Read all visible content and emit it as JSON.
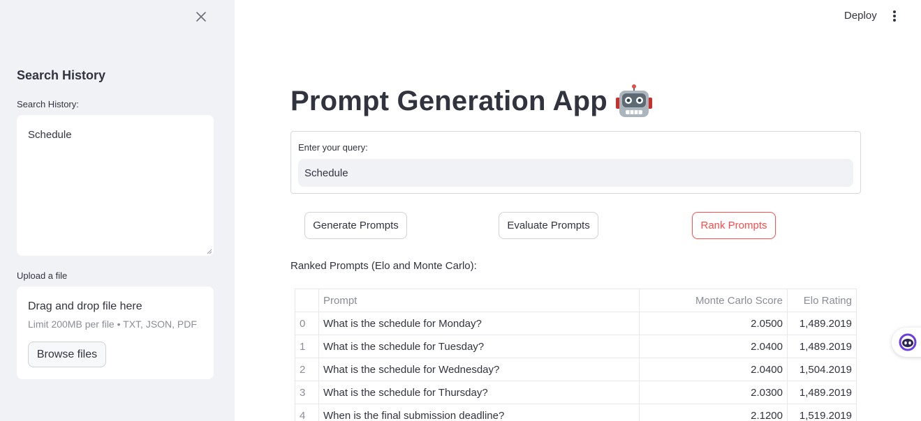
{
  "sidebar": {
    "heading": "Search History",
    "history_label": "Search History:",
    "history_value": "Schedule",
    "upload_label": "Upload a file",
    "upload_title": "Drag and drop file here",
    "upload_limit": "Limit 200MB per file • TXT, JSON, PDF",
    "browse_label": "Browse files"
  },
  "header": {
    "deploy_label": "Deploy"
  },
  "main": {
    "title": "Prompt Generation App",
    "query_label": "Enter your query:",
    "query_value": "Schedule",
    "buttons": {
      "generate": "Generate Prompts",
      "evaluate": "Evaluate Prompts",
      "rank": "Rank Prompts"
    },
    "ranked_label": "Ranked Prompts (Elo and Monte Carlo):",
    "table": {
      "columns": [
        "",
        "Prompt",
        "Monte Carlo Score",
        "Elo Rating"
      ],
      "rows": [
        [
          "0",
          "What is the schedule for Monday?",
          "2.0500",
          "1,489.2019"
        ],
        [
          "1",
          "What is the schedule for Tuesday?",
          "2.0400",
          "1,489.2019"
        ],
        [
          "2",
          "What is the schedule for Wednesday?",
          "2.0400",
          "1,504.2019"
        ],
        [
          "3",
          "What is the schedule for Thursday?",
          "2.0300",
          "1,489.2019"
        ],
        [
          "4",
          "When is the final submission deadline?",
          "2.1200",
          "1,519.2019"
        ]
      ]
    }
  },
  "colors": {
    "accent": "#ff4b4b",
    "sidebar_bg": "#f0f2f6",
    "text": "#31333f",
    "muted": "#8a8d97"
  },
  "icons": {
    "close": "close-icon",
    "menu": "kebab-menu-icon",
    "title_emoji": "robot-icon",
    "chat": "chat-assistant-icon"
  }
}
